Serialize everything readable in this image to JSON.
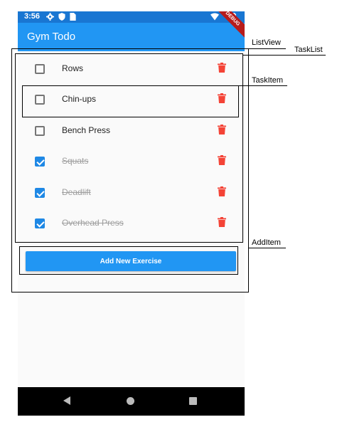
{
  "status_bar": {
    "time": "3:56"
  },
  "app_bar": {
    "title": "Gym Todo",
    "debug_banner": "DEBUG"
  },
  "tasks": [
    {
      "name": "Rows",
      "done": false
    },
    {
      "name": "Chin-ups",
      "done": false
    },
    {
      "name": "Bench Press",
      "done": false
    },
    {
      "name": "Squats",
      "done": true
    },
    {
      "name": "Deadlift",
      "done": true
    },
    {
      "name": "Overhead Press",
      "done": true
    }
  ],
  "add_button": {
    "label": "Add New Exercise"
  },
  "annotations": {
    "listview": "ListView",
    "tasklist": "TaskList",
    "taskitem": "TaskItem",
    "additem": "AddItem"
  },
  "colors": {
    "primary": "#2196f3",
    "status_bar": "#1976d2",
    "delete": "#f44336",
    "checkbox": "#1e88e5"
  },
  "icons": {
    "delete": "trash-icon",
    "settings": "gear-icon",
    "shield": "shield-icon",
    "sim": "sim-card-icon",
    "wifi": "wifi-icon",
    "battery": "battery-icon"
  }
}
